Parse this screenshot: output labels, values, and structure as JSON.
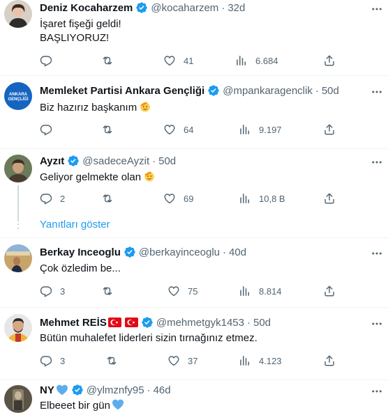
{
  "tweets": [
    {
      "name": "Deniz Kocaharzem",
      "handle": "@kocaharzem",
      "time": "32d",
      "lines": [
        "İşaret fişeği geldi!",
        "BAŞLIYORUZ!"
      ],
      "replies": "",
      "retweets": "",
      "likes": "41",
      "views": "6.684"
    },
    {
      "name": "Memleket Partisi Ankara Gençliği",
      "handle": "@mpankaragenclik",
      "time": "50d",
      "lines": [
        "Biz hazırız başkanım"
      ],
      "replies": "",
      "retweets": "",
      "likes": "64",
      "views": "9.197",
      "avatar_text": "ANKARA GENÇLİĞİ"
    },
    {
      "name": "Ayzıt",
      "handle": "@sadeceAyzit",
      "time": "50d",
      "lines": [
        "Geliyor gelmekte olan"
      ],
      "replies": "2",
      "retweets": "",
      "likes": "69",
      "views": "10,8 B"
    },
    {
      "name": "Berkay Inceoglu",
      "handle": "@berkayinceoglu",
      "time": "40d",
      "lines": [
        "Çok özledim be..."
      ],
      "replies": "3",
      "retweets": "",
      "likes": "75",
      "views": "8.814"
    },
    {
      "name": "Mehmet REİS",
      "handle": "@mehmetgyk1453",
      "time": "50d",
      "lines": [
        "Bütün muhalefet liderleri sizin tırnağınız etmez."
      ],
      "replies": "3",
      "retweets": "",
      "likes": "37",
      "views": "4.123"
    },
    {
      "name": "NY",
      "handle": "@ylmznfy95",
      "time": "46d",
      "lines": [
        "Elbeeet bir gün"
      ]
    }
  ],
  "show_replies_label": "Yanıtları göster",
  "colors": {
    "accent": "#1d9bf0",
    "muted": "#536471",
    "text": "#0f1419"
  }
}
